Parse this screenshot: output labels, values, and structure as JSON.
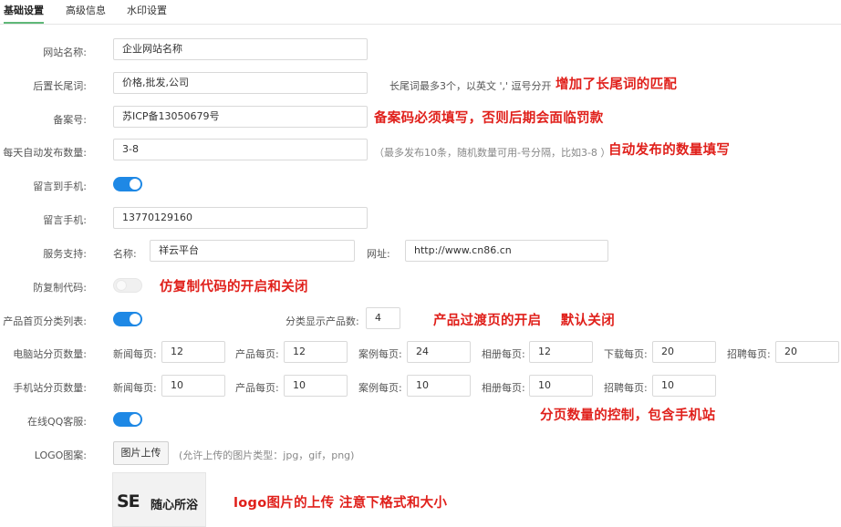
{
  "tabs": [
    "基础设置",
    "高级信息",
    "水印设置"
  ],
  "fields": {
    "site_name": {
      "label": "网站名称:",
      "value": "企业网站名称"
    },
    "longtail": {
      "label": "后置长尾词:",
      "value": "价格,批发,公司",
      "hint": "长尾词最多3个，以英文 ',' 逗号分开"
    },
    "icp": {
      "label": "备案号:",
      "value": "苏ICP备13050679号"
    },
    "daily_publish": {
      "label": "每天自动发布数量:",
      "value": "3-8",
      "hint": "（最多发布10条，随机数量可用-号分隔，比如3-8 ）"
    },
    "msg_to_phone": {
      "label": "留言到手机:",
      "enabled": true
    },
    "msg_phone": {
      "label": "留言手机:",
      "value": "13770129160"
    },
    "service": {
      "label": "服务支持:",
      "name_label": "名称:",
      "name_value": "祥云平台",
      "url_label": "网址:",
      "url_value": "http://www.cn86.cn"
    },
    "anti_copy": {
      "label": "防复制代码:",
      "enabled": false
    },
    "product_category": {
      "label": "产品首页分类列表:",
      "enabled": true,
      "count_label": "分类显示产品数:",
      "count_value": "4"
    },
    "pc_paging": {
      "label": "电脑站分页数量:",
      "items": [
        {
          "label": "新闻每页:",
          "value": "12"
        },
        {
          "label": "产品每页:",
          "value": "12"
        },
        {
          "label": "案例每页:",
          "value": "24"
        },
        {
          "label": "相册每页:",
          "value": "12"
        },
        {
          "label": "下载每页:",
          "value": "20"
        },
        {
          "label": "招聘每页:",
          "value": "20"
        }
      ]
    },
    "mobile_paging": {
      "label": "手机站分页数量:",
      "items": [
        {
          "label": "新闻每页:",
          "value": "10"
        },
        {
          "label": "产品每页:",
          "value": "10"
        },
        {
          "label": "案例每页:",
          "value": "10"
        },
        {
          "label": "相册每页:",
          "value": "10"
        },
        {
          "label": "招聘每页:",
          "value": "10"
        }
      ]
    },
    "qq_service": {
      "label": "在线QQ客服:",
      "enabled": true
    },
    "logo": {
      "label": "LOGO图案:",
      "button": "图片上传",
      "hint": "(允许上传的图片类型：jpg，gif，png)",
      "preview_mark": "SE",
      "preview_text": "随心所浴"
    }
  },
  "annotations": {
    "longtail": "增加了长尾词的匹配",
    "icp": "备案码必须填写，否则后期会面临罚款",
    "daily_publish": "自动发布的数量填写",
    "anti_copy": "仿复制代码的开启和关闭",
    "product_transition": "产品过渡页的开启    默认关闭",
    "paging": "分页数量的控制，包含手机站",
    "logo": "logo图片的上传  注意下格式和大小"
  },
  "colors": {
    "accent": "#1e88e5",
    "annotation": "#e0201b",
    "tab_active": "#5fb878"
  }
}
